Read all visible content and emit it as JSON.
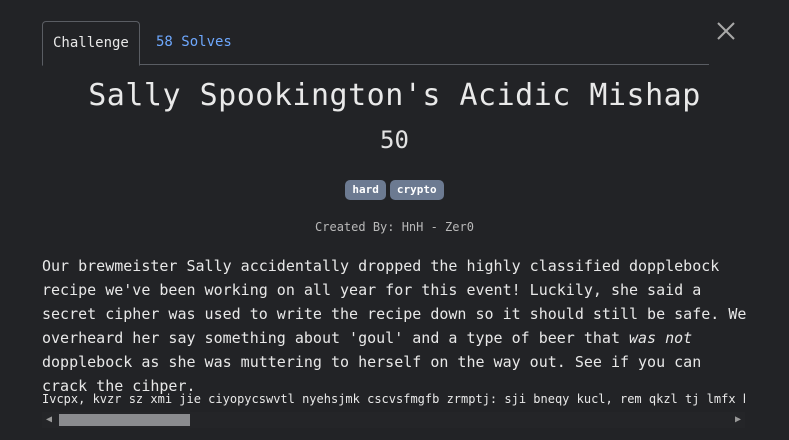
{
  "tabs": {
    "challenge_label": "Challenge",
    "solves_label": "58 Solves"
  },
  "icons": {
    "close": "close-icon",
    "scroll_left": "chevron-left-icon",
    "scroll_right": "chevron-right-icon"
  },
  "challenge": {
    "title": "Sally Spookington's Acidic Mishap",
    "points": "50",
    "tags": [
      "hard",
      "crypto"
    ],
    "author": "Created By: HnH - Zer0",
    "description": {
      "part1": "Our brewmeister Sally accidentally dropped the highly classified dopplebock recipe we've been working on all year for this event! Luckily, she said a secret cipher was used to write the recipe down so it should still be safe. We overheard her say something about 'goul' and a type of beer that ",
      "emphasis": "was not",
      "part2": " dopplebock as she was muttering to herself on the way out. See if you can crack the cihper."
    },
    "cipher_text": "Ivcpx, kvzr sz xmi jie ciyopycswvtl nyehsjmk cscvsfmgfb zrmptj: sji bneqy kucl, rem qkzl tj lmfx h"
  },
  "colors": {
    "background": "#222326",
    "tag_bg": "#6c7a91",
    "link": "#6ea8fe"
  }
}
